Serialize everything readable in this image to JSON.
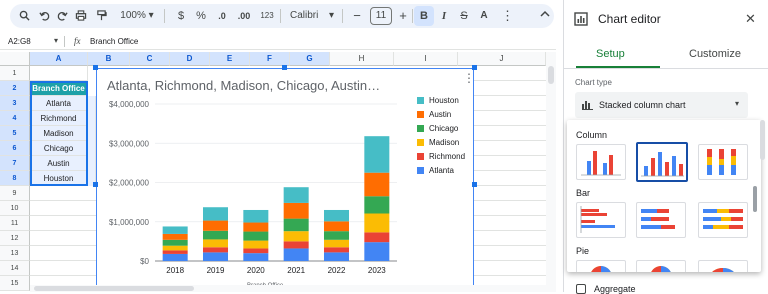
{
  "toolbar": {
    "zoom": "100%",
    "currency": "$",
    "percent": "%",
    "dec_decrease": ".0",
    "dec_increase": ".00",
    "number_format": "123",
    "font": "Calibri",
    "font_size": "11",
    "minus": "−",
    "plus": "+",
    "bold": "B",
    "italic": "I",
    "strike": "S",
    "text_color": "A"
  },
  "formula_bar": {
    "cell_ref": "A2:G8",
    "fx": "fx",
    "content": "Branch Office"
  },
  "columns": [
    "A",
    "B",
    "C",
    "D",
    "E",
    "F",
    "G",
    "H",
    "I",
    "J"
  ],
  "rows": [
    "1",
    "2",
    "3",
    "4",
    "5",
    "6",
    "7",
    "8",
    "9",
    "10",
    "11",
    "12",
    "13",
    "14",
    "15"
  ],
  "cells": [
    "Branch Office",
    "Atlanta",
    "Richmond",
    "Madison",
    "Chicago",
    "Austin",
    "Houston"
  ],
  "chart_data": {
    "type": "bar",
    "stacked": true,
    "title": "Atlanta, Richmond, Madison, Chicago, Austin…",
    "categories": [
      "2018",
      "2019",
      "2020",
      "2021",
      "2022",
      "2023"
    ],
    "y_ticks": [
      "$4,000,000",
      "$3,000,000",
      "$2,000,000",
      "$1,000,000",
      "$0"
    ],
    "ylim": [
      0,
      4000000
    ],
    "series": [
      {
        "name": "Atlanta",
        "color": "#4285f4",
        "values": [
          180000,
          220000,
          200000,
          320000,
          220000,
          480000
        ]
      },
      {
        "name": "Richmond",
        "color": "#ea4335",
        "values": [
          90000,
          130000,
          120000,
          180000,
          130000,
          250000
        ]
      },
      {
        "name": "Madison",
        "color": "#fbbc04",
        "values": [
          120000,
          200000,
          200000,
          260000,
          190000,
          480000
        ]
      },
      {
        "name": "Chicago",
        "color": "#34a853",
        "values": [
          150000,
          220000,
          230000,
          320000,
          220000,
          440000
        ]
      },
      {
        "name": "Austin",
        "color": "#ff6d01",
        "values": [
          150000,
          260000,
          230000,
          400000,
          250000,
          600000
        ]
      },
      {
        "name": "Houston",
        "color": "#46bdc6",
        "values": [
          190000,
          340000,
          320000,
          400000,
          290000,
          930000
        ]
      }
    ],
    "legend_position": "right",
    "xlabel_partial": "Branch Office"
  },
  "editor": {
    "title": "Chart editor",
    "tab_setup": "Setup",
    "tab_customize": "Customize",
    "chart_type_label": "Chart type",
    "chart_type_value": "Stacked column chart",
    "group_column": "Column",
    "group_bar": "Bar",
    "group_pie": "Pie",
    "aggregate": "Aggregate",
    "accent": "#188038"
  }
}
